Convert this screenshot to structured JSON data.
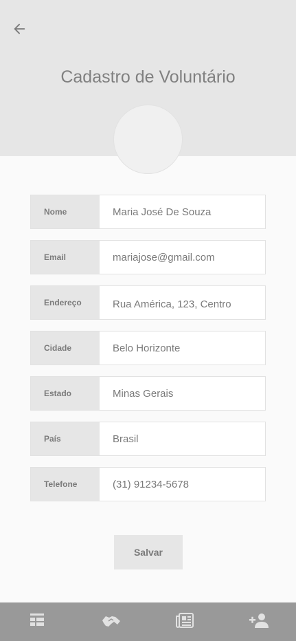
{
  "header": {
    "title": "Cadastro de Voluntário",
    "back_icon": "arrow-left-icon"
  },
  "form": {
    "fields": [
      {
        "label": "Nome",
        "value": "Maria José De Souza"
      },
      {
        "label": "Email",
        "value": "mariajose@gmail.com"
      },
      {
        "label": "Endereço",
        "value": "Rua América, 123, Centro"
      },
      {
        "label": "Cidade",
        "value": "Belo Horizonte"
      },
      {
        "label": "Estado",
        "value": "Minas Gerais"
      },
      {
        "label": "País",
        "value": "Brasil"
      },
      {
        "label": "Telefone",
        "value": "(31) 91234-5678"
      }
    ],
    "save_label": "Salvar"
  },
  "bottom_nav": {
    "items": [
      "list-icon",
      "handshake-icon",
      "newspaper-icon",
      "add-user-icon"
    ]
  },
  "colors": {
    "header_bg": "#e6e6e6",
    "nav_bg": "#999999",
    "text": "#7a7a7a"
  }
}
